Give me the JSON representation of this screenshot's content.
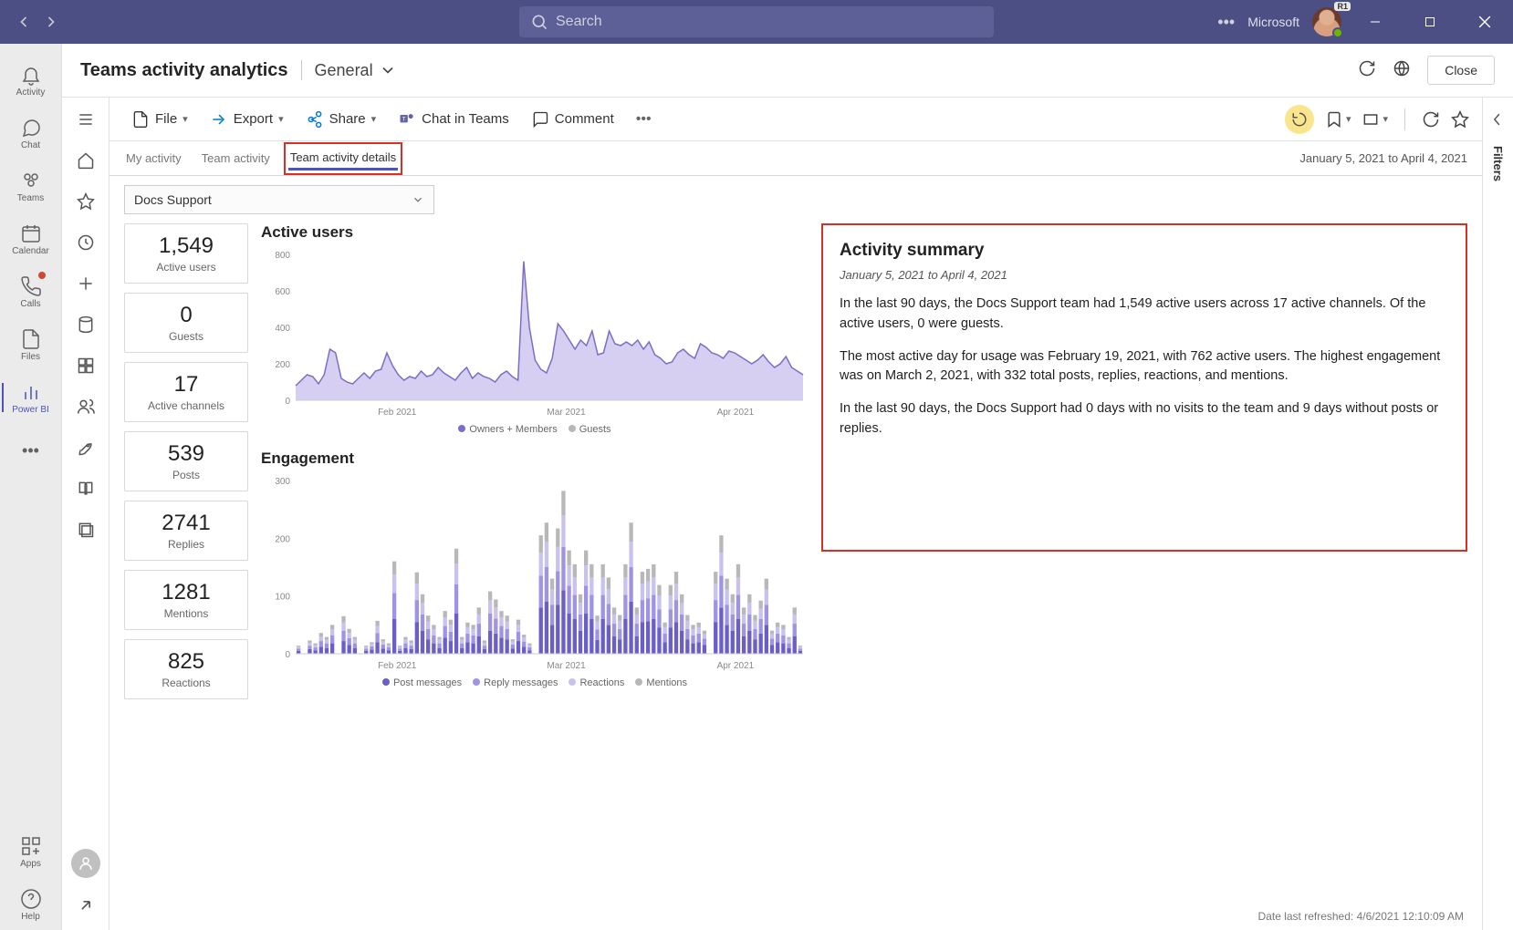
{
  "titlebar": {
    "search_placeholder": "Search",
    "org_name": "Microsoft",
    "avatar_badge": "R1"
  },
  "rail": {
    "items": [
      {
        "key": "activity",
        "label": "Activity"
      },
      {
        "key": "chat",
        "label": "Chat"
      },
      {
        "key": "teams",
        "label": "Teams"
      },
      {
        "key": "calendar",
        "label": "Calendar"
      },
      {
        "key": "calls",
        "label": "Calls"
      },
      {
        "key": "files",
        "label": "Files"
      },
      {
        "key": "powerbi",
        "label": "Power BI"
      }
    ],
    "more": "…",
    "apps": "Apps",
    "help": "Help"
  },
  "page": {
    "title": "Teams activity analytics",
    "channel": "General",
    "close": "Close"
  },
  "toolbar": {
    "file": "File",
    "export": "Export",
    "share": "Share",
    "chat": "Chat in Teams",
    "comment": "Comment"
  },
  "report": {
    "tabs": [
      "My activity",
      "Team activity",
      "Team activity details"
    ],
    "date_range": "January 5, 2021 to April 4, 2021",
    "selected_team": "Docs Support",
    "refresh_stamp": "Date last refreshed: 4/6/2021 12:10:09 AM"
  },
  "stats": {
    "active_users": {
      "value": "1,549",
      "label": "Active users"
    },
    "guests": {
      "value": "0",
      "label": "Guests"
    },
    "channels": {
      "value": "17",
      "label": "Active channels"
    },
    "posts": {
      "value": "539",
      "label": "Posts"
    },
    "replies": {
      "value": "2741",
      "label": "Replies"
    },
    "mentions": {
      "value": "1281",
      "label": "Mentions"
    },
    "reactions": {
      "value": "825",
      "label": "Reactions"
    }
  },
  "summary": {
    "title": "Activity summary",
    "range": "January 5, 2021 to April 4, 2021",
    "p1": "In the last 90 days, the Docs Support team had 1,549 active users across 17 active channels. Of the active users, 0 were guests.",
    "p2": "The most active day for usage was February 19, 2021, with 762 active users. The highest engagement was on March 2, 2021, with 332  total posts, replies, reactions, and mentions.",
    "p3": "In the last 90 days, the Docs Support had 0 days with no visits to the team and 9 days without posts or replies."
  },
  "charts": {
    "active": {
      "title": "Active users",
      "xticks": [
        "Feb 2021",
        "Mar 2021",
        "Apr 2021"
      ],
      "yticks": [
        0,
        200,
        400,
        600,
        800
      ],
      "legend": [
        "Owners + Members",
        "Guests"
      ]
    },
    "engage": {
      "title": "Engagement",
      "xticks": [
        "Feb 2021",
        "Mar 2021",
        "Apr 2021"
      ],
      "yticks": [
        0,
        100,
        200,
        300
      ],
      "legend": [
        "Post messages",
        "Reply messages",
        "Reactions",
        "Mentions"
      ]
    }
  },
  "filters": {
    "label": "Filters"
  },
  "colors": {
    "purple": "#7a6fc4",
    "purple_light": "#b6adea",
    "gray": "#b8b8b8",
    "accent_yellow": "#f8e58c",
    "highlight": "#d93025",
    "brand": "#4b53bc"
  },
  "chart_data": [
    {
      "type": "area",
      "title": "Active users",
      "ylabel": "",
      "xlabel": "",
      "ylim": [
        0,
        800
      ],
      "x_range": [
        "2021-01-05",
        "2021-04-04"
      ],
      "xticks": [
        "Feb 2021",
        "Mar 2021",
        "Apr 2021"
      ],
      "series": [
        {
          "name": "Owners + Members",
          "color": "#7a6fc4",
          "values": [
            80,
            110,
            140,
            130,
            90,
            140,
            280,
            260,
            120,
            100,
            90,
            120,
            150,
            120,
            160,
            170,
            260,
            190,
            140,
            110,
            130,
            120,
            160,
            130,
            140,
            180,
            150,
            130,
            110,
            150,
            180,
            120,
            150,
            130,
            120,
            100,
            140,
            160,
            130,
            110,
            762,
            400,
            220,
            170,
            150,
            230,
            420,
            380,
            330,
            280,
            330,
            300,
            380,
            250,
            260,
            380,
            310,
            300,
            320,
            300,
            330,
            280,
            320,
            250,
            230,
            200,
            210,
            260,
            280,
            250,
            230,
            310,
            290,
            260,
            250,
            230,
            270,
            260,
            240,
            220,
            200,
            220,
            250,
            210,
            180,
            200,
            240,
            180,
            160,
            140
          ]
        },
        {
          "name": "Guests",
          "color": "#b8b8b8",
          "values": [
            0,
            0,
            0,
            0,
            0,
            0,
            0,
            0,
            0,
            0,
            0,
            0,
            0,
            0,
            0,
            0,
            0,
            0,
            0,
            0,
            0,
            0,
            0,
            0,
            0,
            0,
            0,
            0,
            0,
            0,
            0,
            0,
            0,
            0,
            0,
            0,
            0,
            0,
            0,
            0,
            0,
            0,
            0,
            0,
            0,
            0,
            0,
            0,
            0,
            0,
            0,
            0,
            0,
            0,
            0,
            0,
            0,
            0,
            0,
            0,
            0,
            0,
            0,
            0,
            0,
            0,
            0,
            0,
            0,
            0,
            0,
            0,
            0,
            0,
            0,
            0,
            0,
            0,
            0,
            0,
            0,
            0,
            0,
            0,
            0,
            0,
            0,
            0,
            0,
            0
          ]
        }
      ],
      "annotations": {
        "peak_day": "2021-02-19",
        "peak_value": 762
      }
    },
    {
      "type": "bar",
      "title": "Engagement",
      "ylabel": "",
      "xlabel": "",
      "ylim": [
        0,
        300
      ],
      "x_range": [
        "2021-01-05",
        "2021-04-04"
      ],
      "xticks": [
        "Feb 2021",
        "Mar 2021",
        "Apr 2021"
      ],
      "stacked": true,
      "series": [
        {
          "name": "Post messages",
          "color": "#6a5ec7",
          "values": [
            5,
            0,
            8,
            6,
            12,
            10,
            18,
            0,
            22,
            15,
            10,
            0,
            5,
            7,
            20,
            9,
            6,
            60,
            5,
            10,
            8,
            55,
            40,
            25,
            18,
            10,
            28,
            22,
            70,
            10,
            20,
            18,
            30,
            8,
            40,
            35,
            28,
            25,
            9,
            22,
            12,
            6,
            0,
            80,
            90,
            50,
            85,
            110,
            70,
            60,
            40,
            70,
            60,
            24,
            60,
            50,
            30,
            25,
            60,
            90,
            30,
            55,
            56,
            60,
            45,
            20,
            45,
            55,
            40,
            25,
            18,
            20,
            15,
            0,
            55,
            80,
            50,
            40,
            60,
            30,
            40,
            25,
            35,
            50,
            15,
            20,
            18,
            10,
            30,
            5
          ]
        },
        {
          "name": "Reply messages",
          "color": "#9f94e3",
          "values": [
            4,
            0,
            6,
            5,
            10,
            8,
            14,
            0,
            18,
            12,
            8,
            0,
            4,
            6,
            16,
            7,
            5,
            45,
            4,
            8,
            6,
            38,
            28,
            18,
            14,
            8,
            20,
            16,
            50,
            8,
            15,
            14,
            22,
            6,
            30,
            26,
            20,
            18,
            7,
            16,
            9,
            5,
            0,
            55,
            60,
            35,
            58,
            75,
            48,
            42,
            28,
            48,
            42,
            18,
            42,
            36,
            22,
            18,
            42,
            60,
            22,
            38,
            40,
            42,
            32,
            15,
            32,
            38,
            28,
            18,
            14,
            15,
            11,
            0,
            38,
            55,
            35,
            28,
            42,
            22,
            28,
            18,
            25,
            35,
            11,
            15,
            14,
            8,
            22,
            4
          ]
        },
        {
          "name": "Reactions",
          "color": "#c8c2ef",
          "values": [
            3,
            0,
            5,
            4,
            8,
            6,
            10,
            0,
            14,
            9,
            6,
            0,
            3,
            4,
            12,
            5,
            4,
            32,
            3,
            6,
            5,
            28,
            20,
            13,
            10,
            6,
            15,
            12,
            36,
            6,
            11,
            10,
            16,
            5,
            22,
            19,
            15,
            13,
            5,
            12,
            7,
            4,
            0,
            40,
            44,
            26,
            42,
            55,
            35,
            30,
            20,
            35,
            30,
            14,
            30,
            26,
            16,
            14,
            30,
            44,
            16,
            28,
            29,
            30,
            24,
            11,
            24,
            28,
            20,
            14,
            10,
            11,
            8,
            0,
            28,
            40,
            26,
            20,
            30,
            16,
            20,
            14,
            18,
            26,
            8,
            11,
            10,
            6,
            16,
            3
          ]
        },
        {
          "name": "Mentions",
          "color": "#b8b8b8",
          "values": [
            2,
            0,
            4,
            3,
            6,
            5,
            8,
            0,
            11,
            7,
            5,
            0,
            2,
            3,
            9,
            4,
            3,
            23,
            2,
            5,
            4,
            20,
            15,
            10,
            8,
            5,
            11,
            9,
            26,
            5,
            8,
            8,
            12,
            4,
            16,
            14,
            11,
            10,
            4,
            9,
            5,
            3,
            0,
            30,
            33,
            19,
            32,
            42,
            26,
            23,
            15,
            26,
            23,
            10,
            23,
            20,
            12,
            10,
            23,
            33,
            12,
            21,
            22,
            23,
            18,
            8,
            18,
            21,
            15,
            10,
            8,
            8,
            6,
            0,
            21,
            30,
            19,
            15,
            23,
            12,
            15,
            10,
            14,
            19,
            6,
            8,
            8,
            5,
            12,
            2
          ]
        }
      ],
      "annotations": {
        "peak_day": "2021-03-02",
        "peak_total": 332
      }
    }
  ]
}
